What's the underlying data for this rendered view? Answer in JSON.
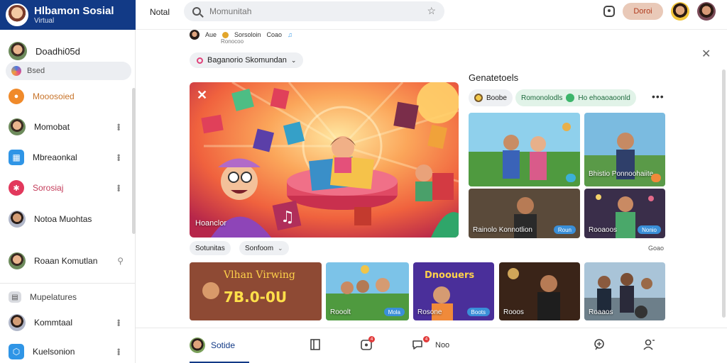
{
  "app": {
    "title": "Hlbamon Sosial",
    "subtitle": "Virtual"
  },
  "sidebar": {
    "header_label": "Doadhi05d",
    "search_pill": "Bsed",
    "items": [
      {
        "label": "Mooosoied",
        "color": "#c8742a"
      },
      {
        "label": "Momobat"
      },
      {
        "label": "Mbreaonkal"
      },
      {
        "label": "Sorosiaj",
        "color": "#c43c5a"
      },
      {
        "label": "Notoa Muohtas"
      },
      {
        "label": "Roaan Komutlan"
      }
    ],
    "section_label": "Mupelatures",
    "bottom_items": [
      {
        "label": "Kommtaal"
      },
      {
        "label": "Kuelsonion"
      }
    ]
  },
  "topbar": {
    "left_label": "Notal",
    "search_placeholder": "Momunitah",
    "cta_label": "Doroi"
  },
  "feed": {
    "postline_name": "Aue",
    "postline_meta": "Sorsoloin",
    "postline_tag": "Coao",
    "postline_sub": "Ronocoo",
    "filter_label": "Baganorio Skomundan",
    "hero_caption": "Hoanclor",
    "tags": [
      "Sotunitas",
      "Sonfoom"
    ],
    "section_title": "Genatetoels",
    "chip_1": "Boobe",
    "chip_2": "Romonolodls",
    "chip_3": "Ho ehoaoaoonld",
    "grid": [
      {
        "caption": "",
        "badge": ""
      },
      {
        "caption": "Bhistio Ponnoohaiite",
        "badge": ""
      },
      {
        "caption": "Rainolo Konnotlion",
        "badge": "Roun"
      },
      {
        "caption": "Rooaoos",
        "badge": "Nonio"
      }
    ],
    "see_all": "Goao",
    "row_cards": [
      {
        "caption": "",
        "overlay": "Vlhan Virwing",
        "big": "7B.0-0U"
      },
      {
        "caption": "Rooolt",
        "badge": "Mola"
      },
      {
        "caption": "Rosone",
        "badge": "Boots",
        "overlay": "Dnoouers"
      },
      {
        "caption": "Rooos",
        "badge": ""
      },
      {
        "caption": "Roaaos",
        "badge": ""
      }
    ]
  },
  "bottomnav": {
    "active_label": "Sotide",
    "more_label": "Noo",
    "badge_1": "4",
    "badge_2": "4"
  },
  "colors": {
    "brand": "#123a86",
    "accent_orange": "#f08a2a",
    "cta_bg": "#e9c9b8",
    "cta_text": "#b03b1e"
  }
}
